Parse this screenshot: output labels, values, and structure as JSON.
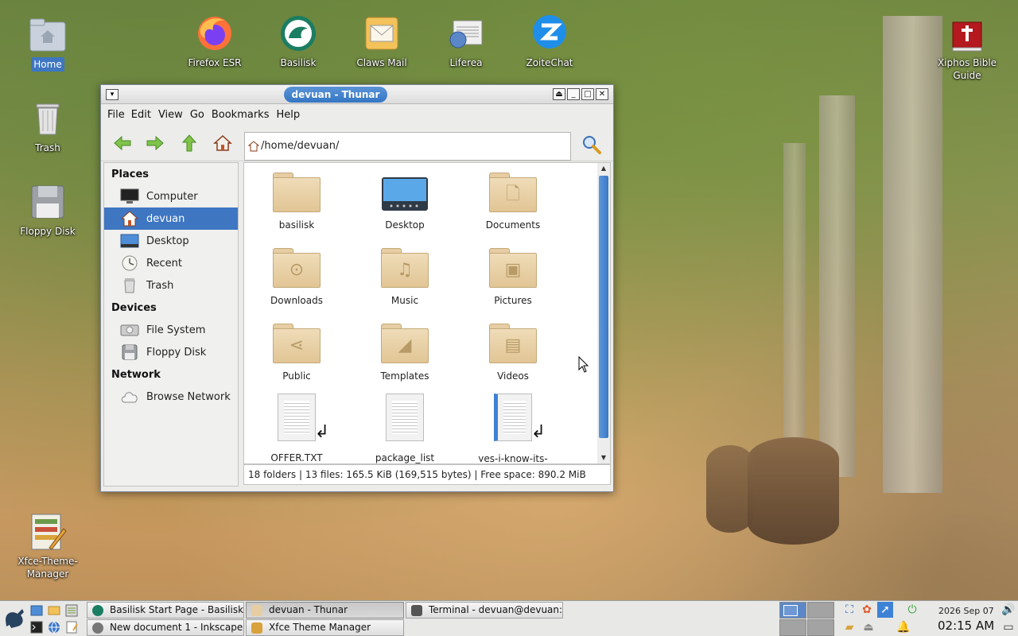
{
  "desktop": {
    "icons": [
      {
        "label": "Home",
        "selected": true
      },
      {
        "label": "Trash"
      },
      {
        "label": "Floppy Disk"
      },
      {
        "label": "Xfce-Theme-\nManager"
      },
      {
        "label": "Firefox ESR"
      },
      {
        "label": "Basilisk"
      },
      {
        "label": "Claws Mail"
      },
      {
        "label": "Liferea"
      },
      {
        "label": "ZoiteChat"
      },
      {
        "label": "Xiphos Bible\nGuide"
      }
    ]
  },
  "window": {
    "title": "devuan - Thunar",
    "controls": [
      "restore",
      "minimize",
      "maximize",
      "close"
    ],
    "menu": [
      "File",
      "Edit",
      "View",
      "Go",
      "Bookmarks",
      "Help"
    ],
    "location": "/home/devuan/",
    "sidebar": {
      "places_header": "Places",
      "places": [
        {
          "label": "Computer",
          "icon": "monitor-icon"
        },
        {
          "label": "devuan",
          "icon": "home-icon",
          "selected": true
        },
        {
          "label": "Desktop",
          "icon": "desktop-icon"
        },
        {
          "label": "Recent",
          "icon": "clock-icon"
        },
        {
          "label": "Trash",
          "icon": "trash-icon"
        }
      ],
      "devices_header": "Devices",
      "devices": [
        {
          "label": "File System",
          "icon": "harddisk-icon"
        },
        {
          "label": "Floppy Disk",
          "icon": "floppy-icon"
        }
      ],
      "network_header": "Network",
      "network": [
        {
          "label": "Browse Network",
          "icon": "cloud-icon"
        }
      ]
    },
    "files": [
      {
        "name": "basilisk",
        "type": "folder",
        "emblem": ""
      },
      {
        "name": "Desktop",
        "type": "desktop-folder",
        "emblem": ""
      },
      {
        "name": "Documents",
        "type": "folder",
        "emblem": "🗋"
      },
      {
        "name": "Downloads",
        "type": "folder",
        "emblem": "⊙"
      },
      {
        "name": "Music",
        "type": "folder",
        "emblem": "♫"
      },
      {
        "name": "Pictures",
        "type": "folder",
        "emblem": "▣"
      },
      {
        "name": "Public",
        "type": "folder",
        "emblem": "⋖"
      },
      {
        "name": "Templates",
        "type": "folder",
        "emblem": "◢"
      },
      {
        "name": "Videos",
        "type": "folder",
        "emblem": "▤"
      },
      {
        "name": "OFFER.TXT",
        "type": "doc-link"
      },
      {
        "name": "package_list",
        "type": "doc"
      },
      {
        "name": "yes-i-know-its-\nbroken.md",
        "type": "doc-link-blue"
      }
    ],
    "status": "18 folders  |  13 files: 165.5 KiB (169,515 bytes)  |  Free space: 890.2 MiB"
  },
  "taskbar": {
    "tasks_row1": [
      {
        "label": "Basilisk Start Page - Basilisk",
        "active": false
      },
      {
        "label": "devuan - Thunar",
        "active": true
      },
      {
        "label": "Terminal - devuan@devuan: ~",
        "active": false
      }
    ],
    "tasks_row2": [
      {
        "label": "New document 1 - Inkscape",
        "active": false
      },
      {
        "label": "Xfce Theme Manager",
        "active": false
      }
    ],
    "clock_date": "2026 Sep 07",
    "clock_time": "02:15 AM"
  }
}
